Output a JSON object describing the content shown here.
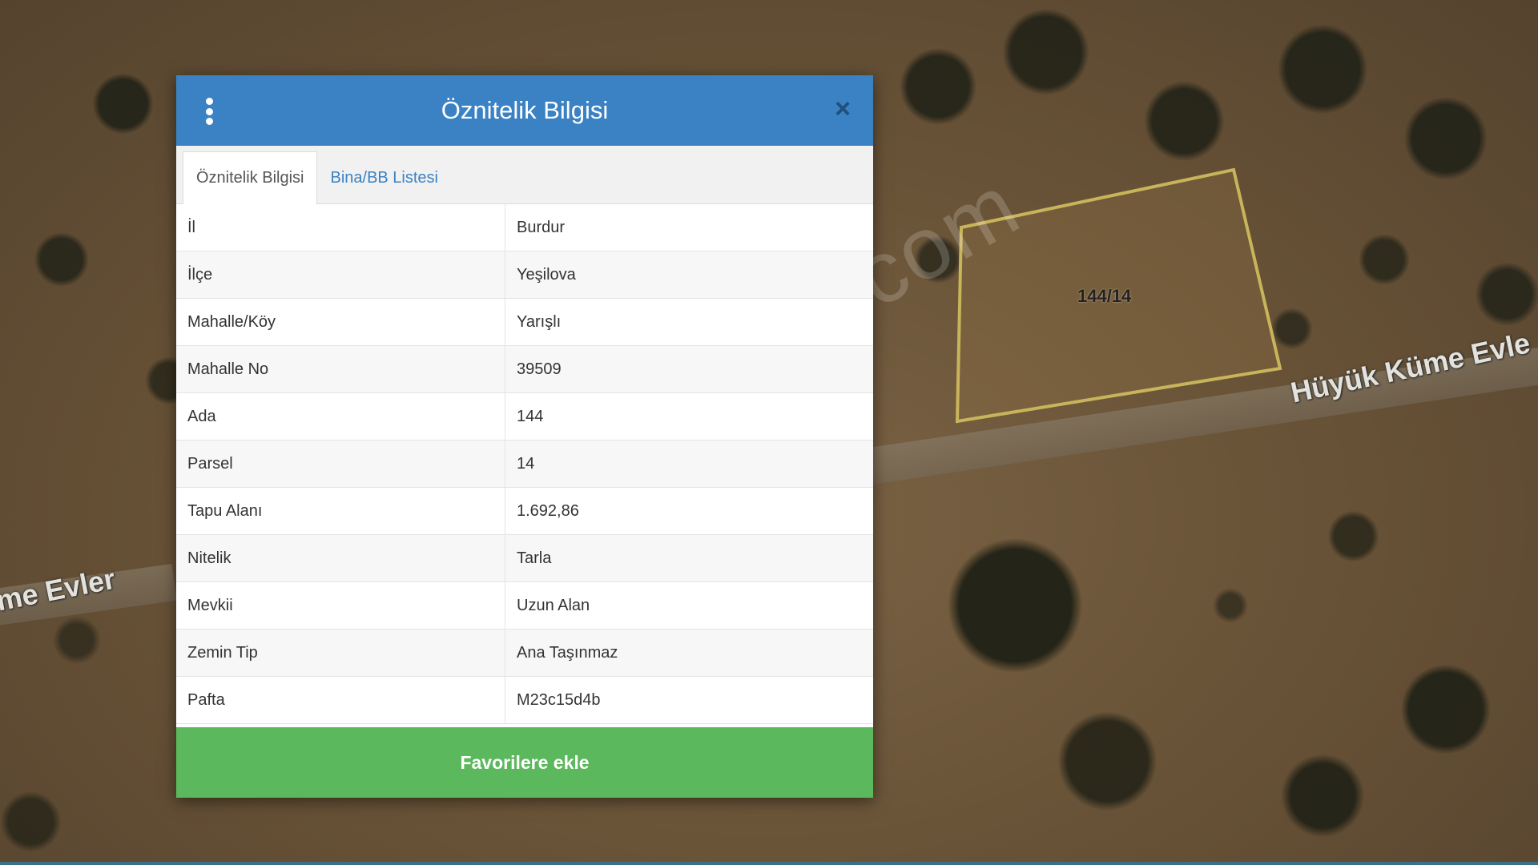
{
  "map": {
    "parcel_label": "144/14",
    "street_right": "Hüyük Küme Evle",
    "street_left": "me Evler",
    "watermark": "emlakjet.com"
  },
  "dialog": {
    "title": "Öznitelik Bilgisi",
    "close_icon": "×",
    "tabs": [
      {
        "label": "Öznitelik Bilgisi",
        "active": true
      },
      {
        "label": "Bina/BB Listesi",
        "active": false
      }
    ],
    "rows": [
      {
        "key": "İl",
        "value": "Burdur"
      },
      {
        "key": "İlçe",
        "value": "Yeşilova"
      },
      {
        "key": "Mahalle/Köy",
        "value": "Yarışlı"
      },
      {
        "key": "Mahalle No",
        "value": "39509"
      },
      {
        "key": "Ada",
        "value": "144"
      },
      {
        "key": "Parsel",
        "value": "14"
      },
      {
        "key": "Tapu Alanı",
        "value": "1.692,86"
      },
      {
        "key": "Nitelik",
        "value": "Tarla"
      },
      {
        "key": "Mevkii",
        "value": "Uzun Alan"
      },
      {
        "key": "Zemin Tip",
        "value": "Ana Taşınmaz"
      },
      {
        "key": "Pafta",
        "value": "M23c15d4b"
      }
    ],
    "favorite_button": "Favorilere ekle"
  },
  "colors": {
    "header": "#3a82c4",
    "favorite": "#5cb85c",
    "parcel_outline": "#c8b45a"
  },
  "icons": {
    "menu": "vertical-dots-icon",
    "close": "close-icon"
  }
}
